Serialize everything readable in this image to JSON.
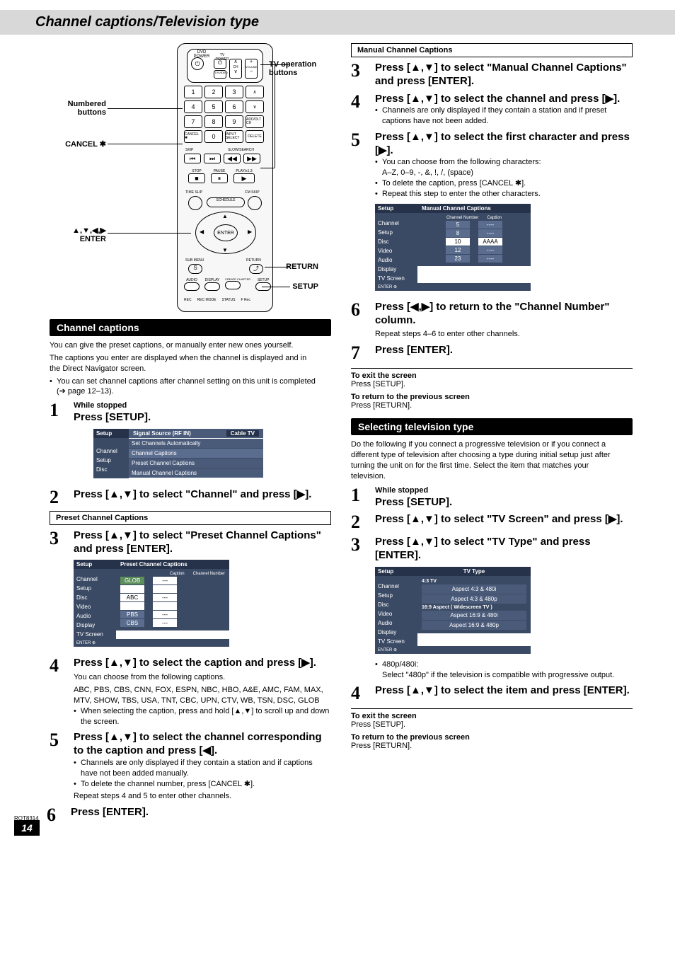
{
  "title": "Channel captions/Television type",
  "remote": {
    "tv_op": "TV operation buttons",
    "numbered": "Numbered buttons",
    "cancel": "CANCEL ✱",
    "arrows_enter": "▲,▼,◀,▶\nENTER",
    "return": "RETURN",
    "setup": "SETUP",
    "labels": {
      "dvd_power": "DVD POWER",
      "tv_power": "TV POWER",
      "tvvideo": "TV/VIDEO",
      "ch": "CH",
      "volume": "VOLUME",
      "add": "ADD/DLT CH",
      "delete": "DELETE",
      "input": "INPUT SELECT",
      "skip": "SKIP",
      "slow": "SLOW/SEARCH",
      "stop": "STOP",
      "pause": "PAUSE",
      "play": "PLAY/x1.3",
      "timeslip": "TIME SLIP",
      "cmskip": "CM SKIP",
      "schedule": "SCHEDULE",
      "enter": "ENTER",
      "submenu": "SUB MENU",
      "ret": "RETURN",
      "audio": "AUDIO",
      "display": "DISPLAY",
      "create": "CREATE CHAPTER",
      "set": "SETUP",
      "rec": "REC",
      "recmode": "REC MODE",
      "status": "STATUS",
      "frec": "F Rec",
      "n1": "1",
      "n2": "2",
      "n3": "3",
      "n4": "4",
      "n5": "5",
      "n6": "6",
      "n7": "7",
      "n8": "8",
      "n9": "9",
      "n0": "0",
      "cancel_btn": "CANCEL ✱",
      "s": "S"
    }
  },
  "section_captions": "Channel captions",
  "intro1": "You can give the preset captions, or manually enter new ones yourself.",
  "intro2": "The captions you enter are displayed when the channel is displayed and in the Direct Navigator screen.",
  "intro3": "You can set channel captions after channel setting on this unit is completed (➔ page 12–13).",
  "left_steps": {
    "s1_pre": "While stopped",
    "s1": "Press [SETUP].",
    "osd1": {
      "hdr": "Setup",
      "tabs": [
        "Channel",
        "Setup",
        "Disc"
      ],
      "title_row": "Signal Source (RF IN)",
      "title_val": "Cable TV",
      "items": [
        "Set Channels Automatically",
        "Channel Captions",
        "Preset Channel Captions",
        "Manual Channel Captions"
      ]
    },
    "s2": "Press [▲,▼] to select \"Channel\" and press [▶].",
    "box_preset": "Preset Channel Captions",
    "s3": "Press [▲,▼] to select \"Preset Channel Captions\" and press [ENTER].",
    "osd2": {
      "hdr": "Setup",
      "tabs": [
        "Channel",
        "Setup",
        "Disc",
        "Video",
        "Audio",
        "Display",
        "TV Screen"
      ],
      "title": "Preset Channel Captions",
      "cols": [
        "Caption",
        "Channel Number"
      ],
      "rows": [
        [
          "GLOB",
          "---"
        ],
        [
          "",
          ""
        ],
        [
          "ABC",
          "---"
        ],
        [
          "",
          ""
        ],
        [
          "PBS",
          "---"
        ],
        [
          "CBS",
          "---"
        ]
      ],
      "enter": "ENTER"
    },
    "s4": "Press [▲,▼] to select the caption and press [▶].",
    "s4a": "You can choose from the following captions.",
    "s4b": "ABC, PBS, CBS, CNN, FOX, ESPN, NBC, HBO, A&E, AMC, FAM, MAX, MTV, SHOW, TBS, USA, TNT, CBC, UPN, CTV, WB, TSN, DSC, GLOB",
    "s4c": "When selecting the caption, press and hold [▲,▼] to scroll up and down the screen.",
    "s5": "Press [▲,▼] to select the channel corresponding to the caption and press [◀].",
    "s5a": "Channels are only displayed if they contain a station and if captions have not been added manually.",
    "s5b": "To delete the channel number, press [CANCEL ✱].",
    "s5c": "Repeat steps 4 and 5 to enter other channels.",
    "s6": "Press [ENTER]."
  },
  "right": {
    "box_manual": "Manual Channel Captions",
    "s3": "Press [▲,▼] to select \"Manual Channel Captions\" and press [ENTER].",
    "s4": "Press [▲,▼] to select the channel and press [▶].",
    "s4a": "Channels are only displayed if they contain a station and if preset captions have not been added.",
    "s5": "Press [▲,▼] to select the first character and press [▶].",
    "s5a": "You can choose from the following characters:",
    "s5b": "A–Z, 0–9, -, &, !, /, (space)",
    "s5c": "To delete the caption, press [CANCEL ✱].",
    "s5d": "Repeat this step to enter the other characters.",
    "osd3": {
      "hdr": "Setup",
      "tabs": [
        "Channel",
        "Setup",
        "Disc",
        "Video",
        "Audio",
        "Display",
        "TV Screen"
      ],
      "title": "Manual Channel Captions",
      "cols": [
        "Channel Number",
        "Caption"
      ],
      "rows": [
        [
          "5",
          "----"
        ],
        [
          "8",
          "----"
        ],
        [
          "10",
          "AAAA"
        ],
        [
          "12",
          "----"
        ],
        [
          "23",
          "----"
        ]
      ],
      "enter": "ENTER"
    },
    "s6": "Press [◀,▶] to return to the \"Channel Number\" column.",
    "s6a": "Repeat steps 4–6 to enter other channels.",
    "s7": "Press [ENTER].",
    "exit1a": "To exit the screen",
    "exit1b": "Press [SETUP].",
    "exit2a": "To return to the previous screen",
    "exit2b": "Press [RETURN].",
    "section_tv": "Selecting television type",
    "tv_intro": "Do the following if you connect a progressive television or if you connect a different type of television after choosing a type during initial setup just after turning the unit on for the first time. Select the item that matches your television.",
    "t1_pre": "While stopped",
    "t1": "Press [SETUP].",
    "t2": "Press [▲,▼] to select \"TV Screen\" and press [▶].",
    "t3": "Press [▲,▼] to select \"TV Type\" and press [ENTER].",
    "osd4": {
      "hdr": "Setup",
      "tabs": [
        "Channel",
        "Setup",
        "Disc",
        "Video",
        "Audio",
        "Display",
        "TV Screen"
      ],
      "title": "TV Type",
      "g1": "4:3 TV",
      "g1a": "Aspect 4:3 & 480i",
      "g1b": "Aspect 4:3 & 480p",
      "g2": "16:9 Aspect ( Widescreen TV )",
      "g2a": "Aspect 16:9 & 480i",
      "g2b": "Aspect 16:9 & 480p",
      "enter": "ENTER"
    },
    "t3a": "480p/480i:",
    "t3b": "Select \"480p\" if the television is compatible with progressive output.",
    "t4": "Press [▲,▼] to select the item and press [ENTER].",
    "exit3a": "To exit the screen",
    "exit3b": "Press [SETUP].",
    "exit4a": "To return to the previous screen",
    "exit4b": "Press [RETURN]."
  },
  "footer": {
    "model": "RQT8314",
    "page": "14"
  }
}
